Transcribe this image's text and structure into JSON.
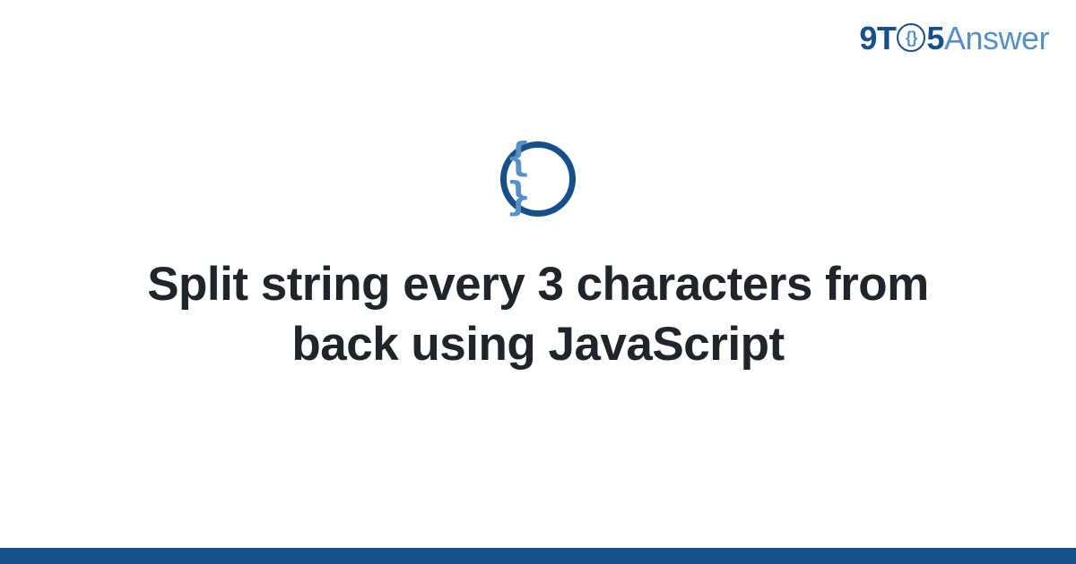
{
  "brand": {
    "part1": "9T",
    "circle_glyph": "{}",
    "part2": "5",
    "part3": "Answer"
  },
  "icon": {
    "name": "code-braces-icon",
    "glyph": "{ }"
  },
  "title": "Split string every 3 characters from back using JavaScript",
  "colors": {
    "primary": "#174e8c",
    "accent": "#5790c9",
    "text": "#212529"
  }
}
